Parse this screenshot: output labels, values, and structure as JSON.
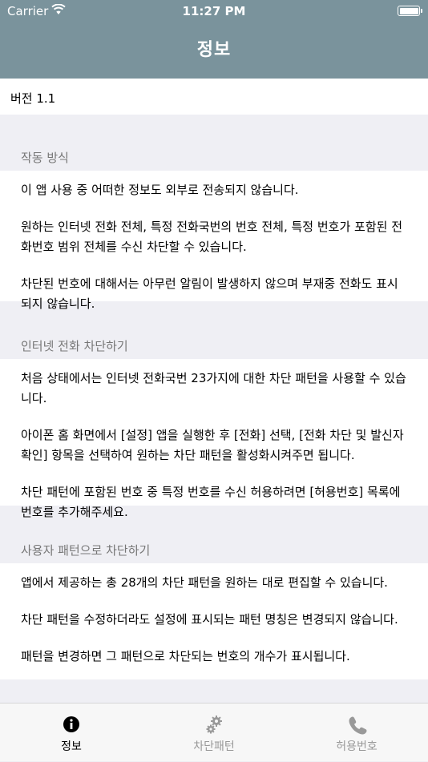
{
  "status_bar": {
    "carrier": "Carrier",
    "time": "11:27 PM"
  },
  "nav": {
    "title": "정보"
  },
  "version": "버전 1.1",
  "sections": [
    {
      "header": "작동 방식",
      "paragraphs": [
        "이 앱 사용 중 어떠한 정보도 외부로 전송되지 않습니다.",
        "원하는 인터넷 전화 전체, 특정 전화국번의 번호 전체, 특정 번호가 포함된 전화번호 범위 전체를 수신 차단할 수 있습니다.",
        "차단된 번호에 대해서는 아무런 알림이 발생하지 않으며 부재중 전화도 표시되지 않습니다."
      ]
    },
    {
      "header": "인터넷 전화 차단하기",
      "paragraphs": [
        "처음 상태에서는 인터넷 전화국번 23가지에 대한 차단 패턴을 사용할 수 있습니다.",
        "아이폰 홈 화면에서 [설정] 앱을 실행한 후 [전화] 선택, [전화 차단 및 발신자 확인] 항목을 선택하여 원하는 차단 패턴을 활성화시켜주면 됩니다.",
        "차단 패턴에 포함된 번호 중 특정 번호를 수신 허용하려면 [허용번호] 목록에 번호를 추가해주세요."
      ]
    },
    {
      "header": "사용자 패턴으로 차단하기",
      "paragraphs": [
        "앱에서 제공하는 총 28개의 차단 패턴을 원하는 대로 편집할 수 있습니다.",
        "차단 패턴을 수정하더라도 설정에 표시되는 패턴 명칭은 변경되지 않습니다.",
        "패턴을 변경하면 그 패턴으로 차단되는 번호의 개수가 표시됩니다."
      ]
    }
  ],
  "tabs": [
    {
      "label": "정보",
      "icon": "info-icon",
      "active": true
    },
    {
      "label": "차단패턴",
      "icon": "gears-icon",
      "active": false
    },
    {
      "label": "허용번호",
      "icon": "phone-icon",
      "active": false
    }
  ],
  "colors": {
    "header": "#7a939c",
    "background": "#efeff4",
    "tab_active": "#000000",
    "tab_inactive": "#999999"
  }
}
